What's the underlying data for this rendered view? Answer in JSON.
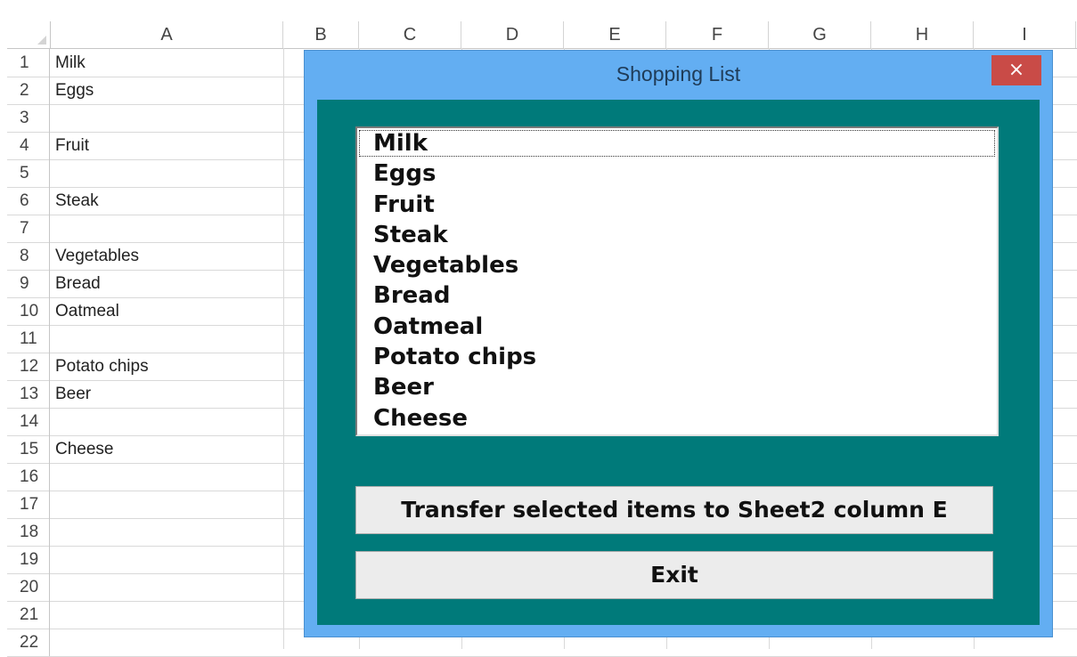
{
  "sheet": {
    "columns": [
      "A",
      "B",
      "C",
      "D",
      "E",
      "F",
      "G",
      "H",
      "I"
    ],
    "rows": [
      {
        "num": "1",
        "a": "Milk"
      },
      {
        "num": "2",
        "a": "Eggs"
      },
      {
        "num": "3",
        "a": ""
      },
      {
        "num": "4",
        "a": "Fruit"
      },
      {
        "num": "5",
        "a": ""
      },
      {
        "num": "6",
        "a": "Steak"
      },
      {
        "num": "7",
        "a": ""
      },
      {
        "num": "8",
        "a": "Vegetables"
      },
      {
        "num": "9",
        "a": "Bread"
      },
      {
        "num": "10",
        "a": "Oatmeal"
      },
      {
        "num": "11",
        "a": ""
      },
      {
        "num": "12",
        "a": "Potato chips"
      },
      {
        "num": "13",
        "a": "Beer"
      },
      {
        "num": "14",
        "a": ""
      },
      {
        "num": "15",
        "a": "Cheese"
      },
      {
        "num": "16",
        "a": ""
      },
      {
        "num": "17",
        "a": ""
      },
      {
        "num": "18",
        "a": ""
      },
      {
        "num": "19",
        "a": ""
      },
      {
        "num": "20",
        "a": ""
      },
      {
        "num": "21",
        "a": ""
      },
      {
        "num": "22",
        "a": ""
      }
    ]
  },
  "dialog": {
    "title": "Shopping List",
    "close_label": "×",
    "close_icon": "close-icon",
    "items": [
      "Milk",
      "Eggs",
      "Fruit",
      "Steak",
      "Vegetables",
      "Bread",
      "Oatmeal",
      "Potato chips",
      "Beer",
      "Cheese"
    ],
    "transfer_label": "Transfer selected items to Sheet2 column E",
    "exit_label": "Exit",
    "colors": {
      "frame": "#63aef2",
      "client": "#007a7a",
      "close": "#c94b47"
    }
  }
}
